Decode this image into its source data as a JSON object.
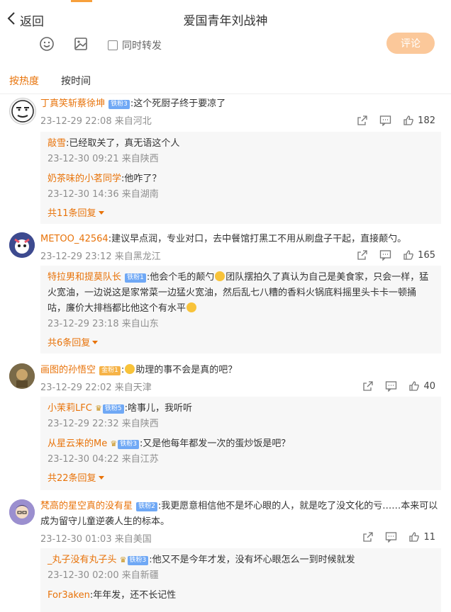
{
  "header": {
    "back_label": "返回",
    "title": "爱国青年刘战神"
  },
  "composer": {
    "repost_label": "同时转发",
    "comment_button": "评论"
  },
  "tabs": {
    "hot": "按热度",
    "time": "按时间"
  },
  "comments": [
    {
      "user": "丁真笑斩蔡徐坤",
      "badge": "铁粉3",
      "text": ":这个死厨子终于要凉了",
      "time": "23-12-29 22:08",
      "location": "来自河北",
      "likes": "182",
      "replies": [
        {
          "user": "敲雪",
          "text": ":已经取关了，真无语这个人",
          "time": "23-12-30 09:21",
          "location": "来自陕西"
        },
        {
          "user": "奶茶味的小茗同学",
          "text": ":他咋了？",
          "time": "23-12-30 14:36",
          "location": "来自湖南"
        }
      ],
      "more": "共11条回复"
    },
    {
      "user": "METOO_42564",
      "badge": "",
      "text": ":建议早点润，专业对口，去中餐馆打黑工不用从刷盘子干起，直接颠勺。",
      "time": "23-12-29 23:12",
      "location": "来自黑龙江",
      "likes": "165",
      "replies": [
        {
          "user": "特拉男和提莫队长",
          "badge": "铁粉1",
          "text": ":他会个毛的颠勺",
          "text2": "团队摆拍久了真认为自己是美食家，只会一样，猛火宽油，一边说这是家常菜一边猛火宽油，然后乱七八糟的香料火锅底料摇里头卡卡一顿捅咕，廉价大排档都比他这个有水平",
          "time": "23-12-29 23:18",
          "location": "来自山东"
        }
      ],
      "more": "共6条回复"
    },
    {
      "user": "画图的孙悟空",
      "badge": "金粉1",
      "text": "助理的事不会是真的吧？",
      "time": "23-12-29 22:02",
      "location": "来自天津",
      "likes": "40",
      "replies": [
        {
          "user": "小茉莉LFC",
          "badge": "铁粉5",
          "text": ":啥事儿，我听听",
          "time": "23-12-29 22:32",
          "location": "来自陕西"
        },
        {
          "user": "从星云来的Me",
          "badge": "铁粉3",
          "text": ":又是他每年都发一次的蛋炒饭是吧？",
          "time": "23-12-30 04:22",
          "location": "来自江苏"
        }
      ],
      "more": "共22条回复"
    },
    {
      "user": "梵高的星空真的没有星",
      "badge": "铁粉2",
      "text": ":我更愿意相信他不是坏心眼的人，就是吃了没文化的亏……本来可以成为留守儿童逆袭人生的标本。",
      "time": "23-12-30 01:03",
      "location": "来自美国",
      "likes": "11",
      "replies": [
        {
          "user": "_丸子没有丸子头",
          "badge": "铁粉3",
          "text": ":他又不是今年才发，没有坏心眼怎么一到时候就发",
          "time": "23-12-30 02:00",
          "location": "来自新疆"
        },
        {
          "user": "For3aken",
          "text": ":年年发，还不长记性"
        }
      ]
    }
  ],
  "colors": {
    "accent": "#e8730a",
    "reply_bg": "#f7f7f7",
    "button": "#fbc89a"
  }
}
